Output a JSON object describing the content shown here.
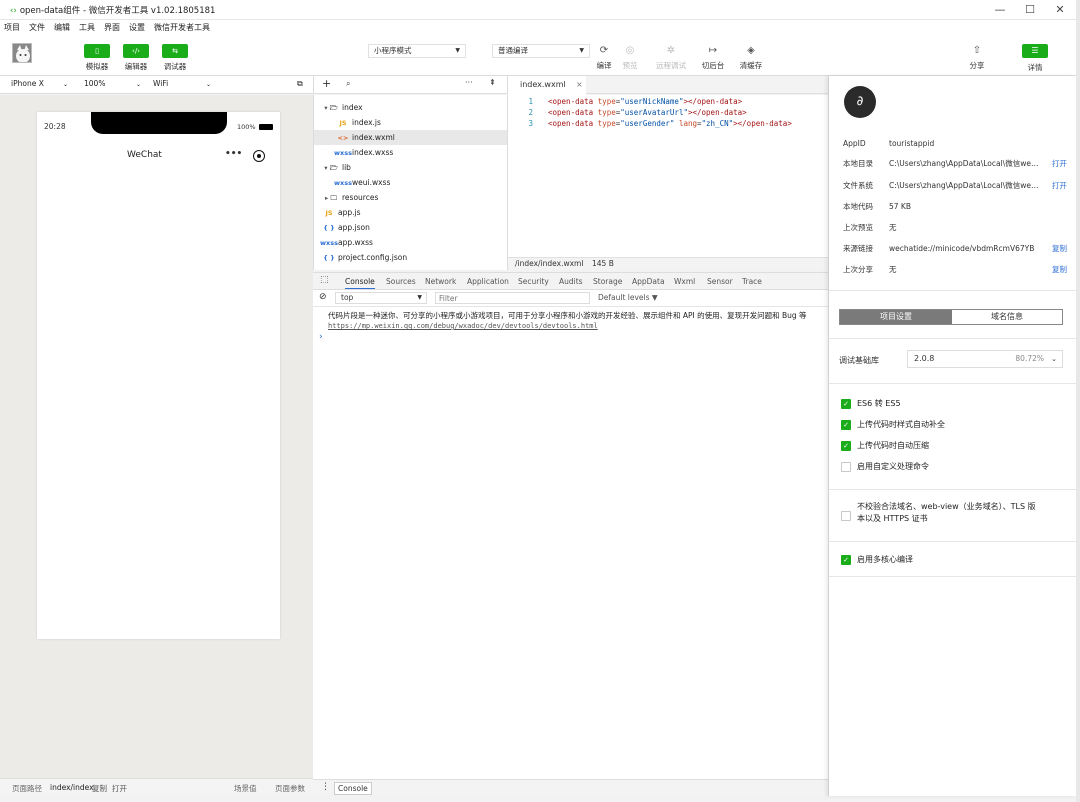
{
  "window": {
    "title": "open-data组件 - 微信开发者工具 v1.02.1805181",
    "controls": {
      "minimize": "—",
      "maximize": "☐",
      "close": "✕"
    }
  },
  "menu": [
    "项目",
    "文件",
    "编辑",
    "工具",
    "界面",
    "设置",
    "微信开发者工具"
  ],
  "toolbar": {
    "mode_buttons": [
      {
        "label": "模拟器",
        "icon": "phone-icon"
      },
      {
        "label": "编辑器",
        "icon": "code-icon"
      },
      {
        "label": "调试器",
        "icon": "debug-icon"
      }
    ],
    "mode_select": "小程序模式",
    "compile_select": "普通编译",
    "tools": [
      {
        "label": "编译",
        "icon": "⟳"
      },
      {
        "label": "预览",
        "icon": "◎"
      },
      {
        "label": "远程调试",
        "icon": "✲"
      },
      {
        "label": "切后台",
        "icon": "↦"
      },
      {
        "label": "清缓存",
        "icon": "◈"
      }
    ],
    "share_label": "分享",
    "details_label": "详情"
  },
  "simulator": {
    "device": "iPhone X",
    "zoom": "100%",
    "network": "WiFi",
    "status_time": "20:28",
    "battery": "100%",
    "nav_title": "WeChat",
    "nav_more": "•••",
    "footer": {
      "path_label": "页面路径",
      "path_value": "index/index",
      "copy": "复制",
      "open": "打开",
      "scene": "场景值",
      "params": "页面参数"
    }
  },
  "filetree": {
    "items": [
      {
        "name": "index",
        "type": "folder-open",
        "level": 0
      },
      {
        "name": "index.js",
        "type": "js",
        "level": 1
      },
      {
        "name": "index.wxml",
        "type": "wxml",
        "level": 1,
        "selected": true
      },
      {
        "name": "index.wxss",
        "type": "wxss",
        "level": 1
      },
      {
        "name": "lib",
        "type": "folder-open",
        "level": 0
      },
      {
        "name": "weui.wxss",
        "type": "wxss",
        "level": 1
      },
      {
        "name": "resources",
        "type": "folder-closed",
        "level": 0
      },
      {
        "name": "app.js",
        "type": "js",
        "level": 0
      },
      {
        "name": "app.json",
        "type": "json",
        "level": 0
      },
      {
        "name": "app.wxss",
        "type": "wxss",
        "level": 0
      },
      {
        "name": "project.config.json",
        "type": "json",
        "level": 0
      }
    ]
  },
  "editor": {
    "tab": "index.wxml",
    "lines": [
      {
        "n": "1",
        "open": "<open-data",
        "attrs": [
          {
            "k": "type",
            "v": "\"userNickName\""
          }
        ],
        "close": "></open-data>"
      },
      {
        "n": "2",
        "open": "<open-data",
        "attrs": [
          {
            "k": "type",
            "v": "\"userAvatarUrl\""
          }
        ],
        "close": "></open-data>"
      },
      {
        "n": "3",
        "open": "<open-data",
        "attrs": [
          {
            "k": "type",
            "v": "\"userGender\""
          },
          {
            "k": "lang",
            "v": "\"zh_CN\""
          }
        ],
        "close": "></open-data>"
      }
    ],
    "status_path": "/index/index.wxml",
    "status_size": "145 B"
  },
  "console": {
    "tabs": [
      "Console",
      "Sources",
      "Network",
      "Application",
      "Security",
      "Audits",
      "Storage",
      "AppData",
      "Wxml",
      "Sensor",
      "Trace"
    ],
    "context": "top",
    "filter_placeholder": "Filter",
    "levels": "Default levels",
    "message": "代码片段是一种迷你、可分享的小程序或小游戏项目，可用于分享小程序和小游戏的开发经验、展示组件和 API 的使用、复现开发问题和 Bug 等",
    "link": "https://mp.weixin.qq.com/debug/wxadoc/dev/devtools/devtools.html",
    "prompt": "›",
    "footer_tab": "Console"
  },
  "details": {
    "rows": [
      {
        "k": "AppID",
        "v": "touristappid",
        "a": ""
      },
      {
        "k": "本地目录",
        "v": "C:\\Users\\zhang\\AppData\\Local\\微信web...",
        "a": "打开"
      },
      {
        "k": "文件系统",
        "v": "C:\\Users\\zhang\\AppData\\Local\\微信web...",
        "a": "打开"
      },
      {
        "k": "本地代码",
        "v": "57 KB",
        "a": ""
      },
      {
        "k": "上次预览",
        "v": "无",
        "a": ""
      },
      {
        "k": "来源链接",
        "v": "wechatide://minicode/vbdmRcmV67YB",
        "a": "复制"
      },
      {
        "k": "上次分享",
        "v": "无",
        "a": "复制"
      }
    ],
    "tabs": [
      "项目设置",
      "域名信息"
    ],
    "lib_label": "调试基础库",
    "lib_version": "2.0.8",
    "lib_percent": "80.72%",
    "checks": [
      {
        "label": "ES6 转 ES5",
        "on": true
      },
      {
        "label": "上传代码时样式自动补全",
        "on": true
      },
      {
        "label": "上传代码时自动压缩",
        "on": true
      },
      {
        "label": "启用自定义处理命令",
        "on": false
      }
    ],
    "domain_check_line1": "不校验合法域名、web-view（业务域名）、TLS 版",
    "domain_check_line2": "本以及 HTTPS 证书",
    "multicore": "启用多核心编译",
    "colors": {
      "accent": "#1aad19",
      "link": "#2e6fd3"
    }
  }
}
